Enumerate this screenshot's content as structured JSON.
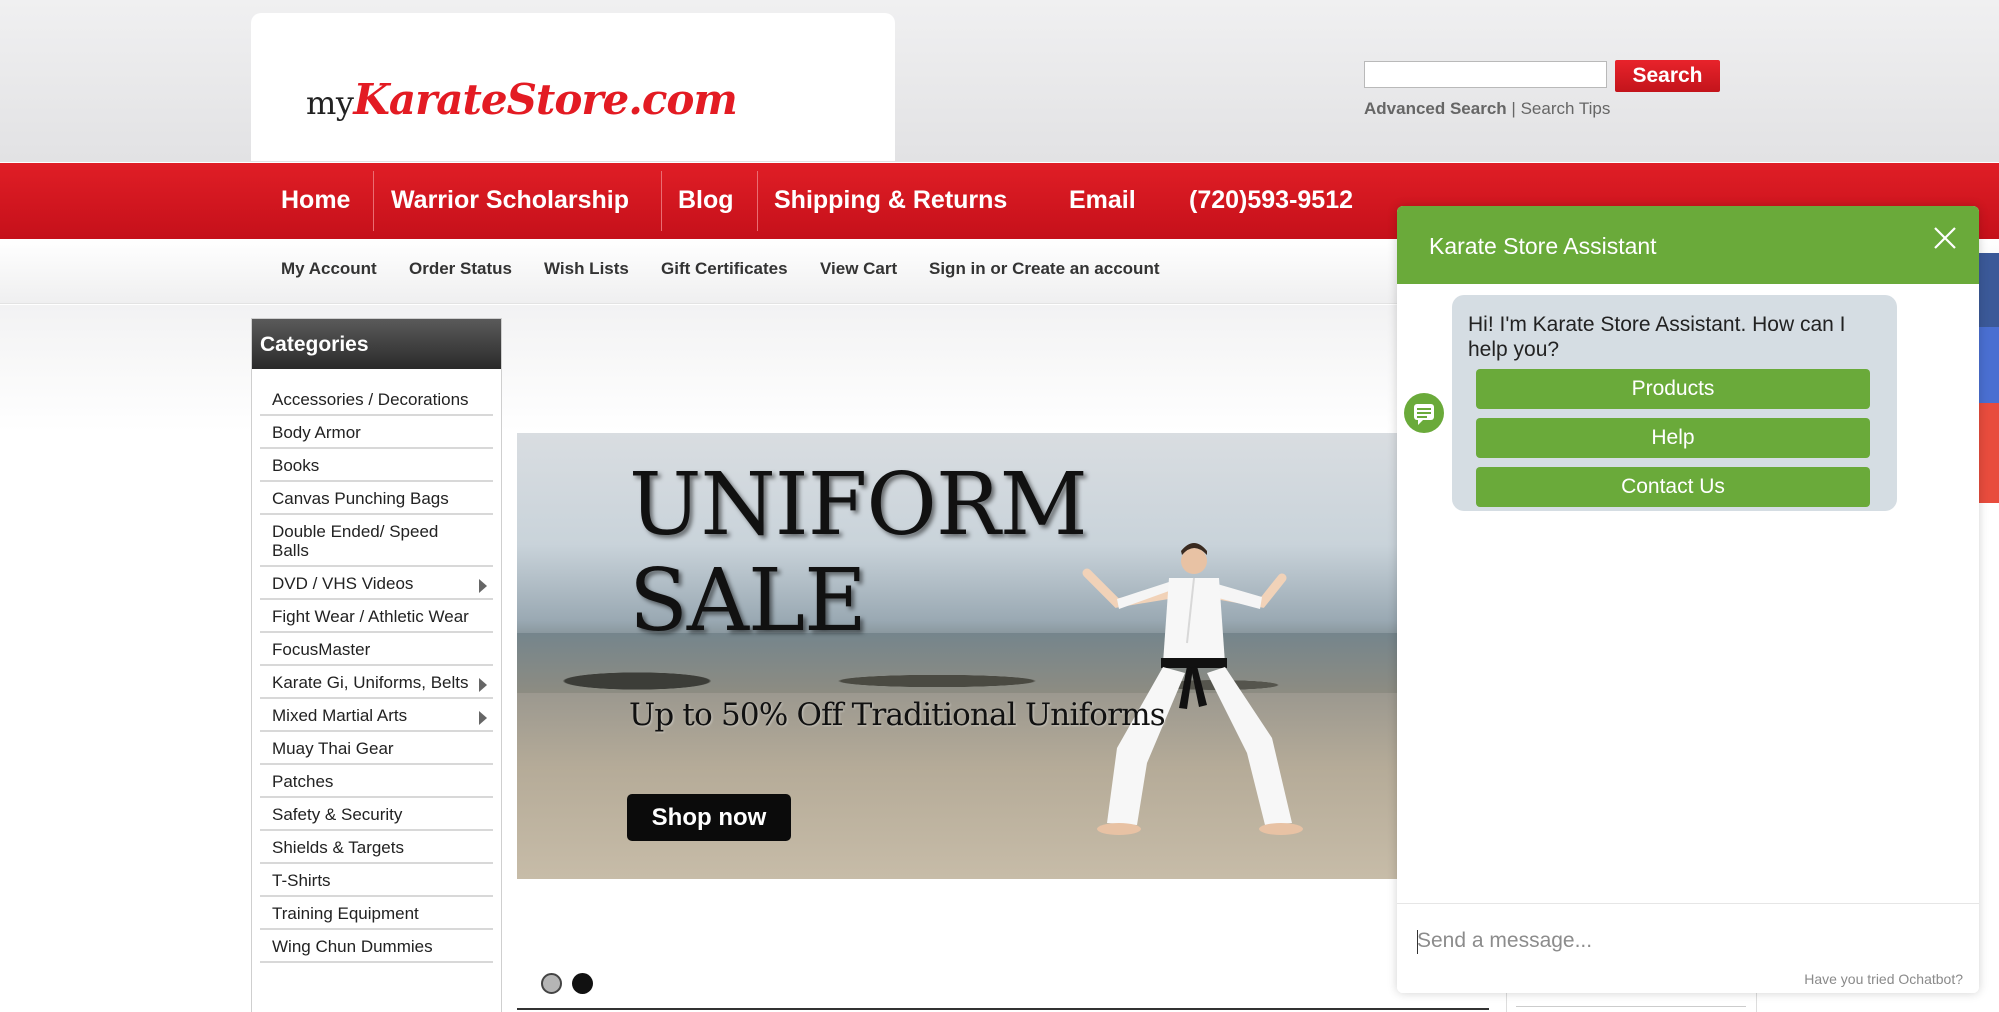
{
  "logo": {
    "prefix": "my",
    "brand": "KarateStore.com"
  },
  "search": {
    "button_label": "Search",
    "value": "",
    "advanced_label": "Advanced Search",
    "separator": "|",
    "tips_label": "Search Tips"
  },
  "main_nav": [
    {
      "label": "Home"
    },
    {
      "label": "Warrior Scholarship"
    },
    {
      "label": "Blog"
    },
    {
      "label": "Shipping & Returns"
    },
    {
      "label": "Email"
    },
    {
      "label": "(720)593-9512"
    }
  ],
  "sub_nav": [
    {
      "label": "My Account"
    },
    {
      "label": "Order Status"
    },
    {
      "label": "Wish Lists"
    },
    {
      "label": "Gift Certificates"
    },
    {
      "label": "View Cart"
    },
    {
      "label": "Sign in or Create an account"
    }
  ],
  "categories": {
    "title": "Categories",
    "items": [
      {
        "label": "Accessories / Decorations",
        "has_submenu": false
      },
      {
        "label": "Body Armor",
        "has_submenu": false
      },
      {
        "label": "Books",
        "has_submenu": false
      },
      {
        "label": "Canvas Punching Bags",
        "has_submenu": false
      },
      {
        "label": "Double Ended/ Speed Balls",
        "has_submenu": false
      },
      {
        "label": "DVD / VHS Videos",
        "has_submenu": true
      },
      {
        "label": "Fight Wear / Athletic Wear",
        "has_submenu": false
      },
      {
        "label": "FocusMaster",
        "has_submenu": false
      },
      {
        "label": "Karate Gi, Uniforms, Belts",
        "has_submenu": true
      },
      {
        "label": "Mixed Martial Arts",
        "has_submenu": true
      },
      {
        "label": "Muay Thai Gear",
        "has_submenu": false
      },
      {
        "label": "Patches",
        "has_submenu": false
      },
      {
        "label": "Safety & Security",
        "has_submenu": false
      },
      {
        "label": "Shields & Targets",
        "has_submenu": false
      },
      {
        "label": "T-Shirts",
        "has_submenu": false
      },
      {
        "label": "Training Equipment",
        "has_submenu": false
      },
      {
        "label": "Wing Chun Dummies",
        "has_submenu": false
      }
    ]
  },
  "banner": {
    "title": "UNIFORM\nSALE",
    "subtitle": "Up to 50% Off Traditional Uniforms",
    "cta_label": "Shop now",
    "slide_count": 2,
    "active_slide": 2
  },
  "chat": {
    "title": "Karate Store Assistant",
    "message": "Hi! I'm Karate Store Assistant. How can I help you?",
    "options": [
      {
        "label": "Products"
      },
      {
        "label": "Help"
      },
      {
        "label": "Contact Us"
      }
    ],
    "input_placeholder": "Send a message...",
    "footer": "Have you tried Ochatbot?"
  },
  "colors": {
    "brand_red": "#e31b23",
    "nav_red": "#d3161f",
    "chat_green": "#6aaa3a",
    "bubble_gray": "#d5dde3"
  },
  "icons": [
    "close-icon",
    "chat-avatar-icon",
    "submenu-arrow-icon"
  ]
}
